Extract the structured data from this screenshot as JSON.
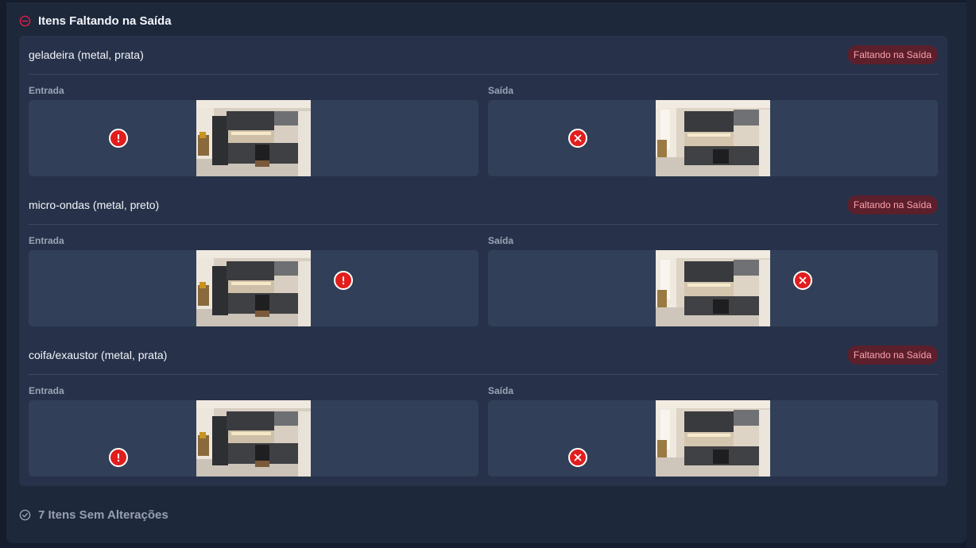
{
  "missing_section": {
    "title": "Itens Faltando na Saída",
    "icon": "minus-circle-icon",
    "accent_color": "#e11d48"
  },
  "items": [
    {
      "title": "geladeira (metal, prata)",
      "badge": "Faltando na Saída",
      "entrada_label": "Entrada",
      "saida_label": "Saída",
      "entrada_marker": "exclamation-icon",
      "saida_marker": "x-icon"
    },
    {
      "title": "micro-ondas (metal, preto)",
      "badge": "Faltando na Saída",
      "entrada_label": "Entrada",
      "saida_label": "Saída",
      "entrada_marker": "exclamation-icon",
      "saida_marker": "x-icon"
    },
    {
      "title": "coifa/exaustor (metal, prata)",
      "badge": "Faltando na Saída",
      "entrada_label": "Entrada",
      "saida_label": "Saída",
      "entrada_marker": "exclamation-icon",
      "saida_marker": "x-icon"
    }
  ],
  "unchanged_section": {
    "title": "7 Itens Sem Alterações",
    "icon": "check-circle-icon"
  },
  "colors": {
    "badge_bg": "#5c1f2c",
    "badge_text": "#fda4af",
    "marker": "#e11d1d"
  }
}
